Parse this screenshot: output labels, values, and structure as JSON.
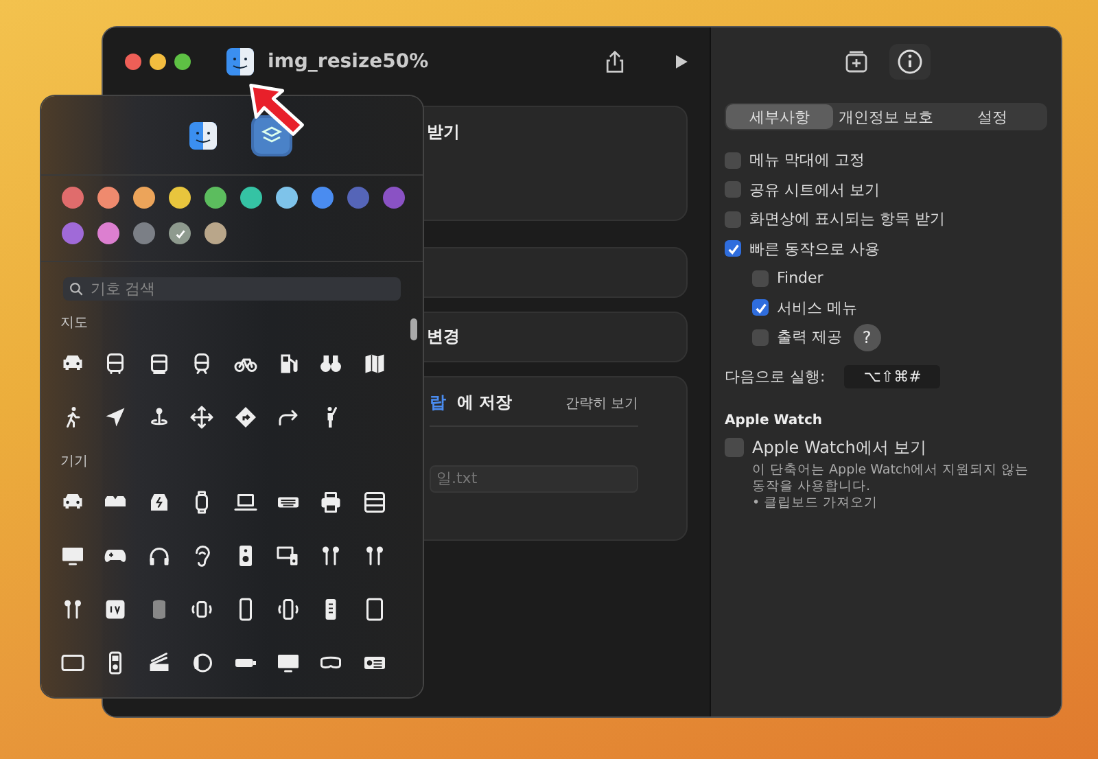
{
  "window": {
    "title": "img_resize50%"
  },
  "editor": {
    "cards": [
      {
        "kind": "text",
        "text": "받기"
      },
      {
        "kind": "empty"
      },
      {
        "kind": "text",
        "text": "변경"
      },
      {
        "kind": "save",
        "link": "랍",
        "text": "에 저장",
        "toggle": "간략히 보기",
        "field": "일.txt"
      }
    ]
  },
  "glyph_popover": {
    "icon_tabs": [
      {
        "selected": false
      },
      {
        "selected": true
      }
    ],
    "colors": [
      {
        "color": "#e06c6c",
        "selected": false
      },
      {
        "color": "#ef8a6e",
        "selected": false
      },
      {
        "color": "#eca45a",
        "selected": false
      },
      {
        "color": "#e8c53d",
        "selected": false
      },
      {
        "color": "#5cbd5e",
        "selected": false
      },
      {
        "color": "#35c3a4",
        "selected": false
      },
      {
        "color": "#7ec3ea",
        "selected": false
      },
      {
        "color": "#4a8cf0",
        "selected": false
      },
      {
        "color": "#5565b8",
        "selected": false
      },
      {
        "color": "#8a52c4",
        "selected": false
      },
      {
        "color": "#a06ad8",
        "selected": false
      },
      {
        "color": "#dc7fd0",
        "selected": false
      },
      {
        "color": "#7b7f86",
        "selected": false
      },
      {
        "color": "#8e9a8e",
        "selected": true
      },
      {
        "color": "#b9a68a",
        "selected": false
      }
    ],
    "search": {
      "placeholder": "기호 검색"
    },
    "sections": [
      {
        "title": "지도"
      },
      {
        "title": "기기"
      }
    ]
  },
  "inspector": {
    "tabs": [
      {
        "label": "세부사항",
        "selected": true
      },
      {
        "label": "개인정보 보호",
        "selected": false
      },
      {
        "label": "설정",
        "selected": false
      }
    ],
    "options": [
      {
        "label": "메뉴 막대에 고정",
        "checked": false
      },
      {
        "label": "공유 시트에서 보기",
        "checked": false
      },
      {
        "label": "화면상에 표시되는 항목 받기",
        "checked": false
      },
      {
        "label": "빠른 동작으로 사용",
        "checked": true,
        "children": [
          {
            "label": "Finder",
            "checked": false
          },
          {
            "label": "서비스 메뉴",
            "checked": true
          },
          {
            "label": "출력 제공",
            "checked": false,
            "help": "?"
          }
        ]
      }
    ],
    "shortcut": {
      "label": "다음으로 실행:",
      "keys": "⌥⇧⌘#"
    },
    "apple_watch": {
      "title": "Apple Watch",
      "option": {
        "label": "Apple Watch에서 보기",
        "checked": false
      },
      "note": "이 단축어는 Apple Watch에서 지원되지 않는 동작을 사용합니다.",
      "bullet": "• 클립보드 가져오기"
    }
  }
}
